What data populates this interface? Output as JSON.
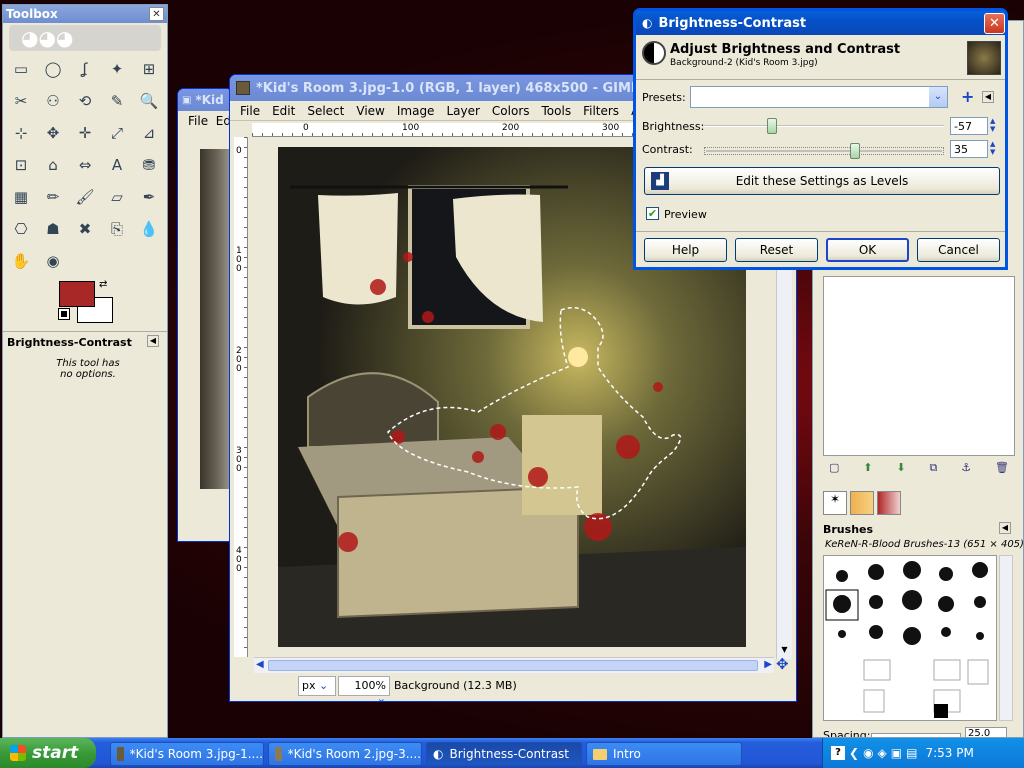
{
  "toolbox": {
    "title": "Toolbox",
    "tool_options_title": "Brightness-Contrast",
    "no_options": "This tool has no options."
  },
  "bg_window": {
    "title": "*Kid",
    "menu_file": "File",
    "menu_edit": "Ed"
  },
  "image_window": {
    "title": "*Kid's Room 3.jpg-1.0 (RGB, 1 layer) 468x500 - GIMP",
    "menu": [
      "File",
      "Edit",
      "Select",
      "View",
      "Image",
      "Layer",
      "Colors",
      "Tools",
      "Filters",
      "Animate"
    ],
    "ruler_h": [
      "0",
      "100",
      "200",
      "300"
    ],
    "ruler_v": [
      "0",
      "1\n0\n0",
      "2\n0\n0",
      "3\n0\n0",
      "4\n0\n0"
    ],
    "unit": "px",
    "zoom": "100%",
    "status": "Background (12.3 MB)"
  },
  "dialog": {
    "title": "Brightness-Contrast",
    "heading": "Adjust Brightness and Contrast",
    "subheading": "Background-2 (Kid's Room 3.jpg)",
    "presets_label": "Presets:",
    "presets_value": "",
    "brightness_label": "Brightness:",
    "brightness_value": "-57",
    "brightness_level": -57,
    "contrast_label": "Contrast:",
    "contrast_value": "35",
    "contrast_level": 35,
    "levels_button": "Edit these Settings as Levels",
    "preview_label": "Preview",
    "preview_checked": true,
    "help": "Help",
    "reset": "Reset",
    "ok": "OK",
    "cancel": "Cancel"
  },
  "right_dock": {
    "brushes_title": "Brushes",
    "brush_name": "KeReN-R-Blood Brushes-13 (651 × 405)",
    "spacing_label": "Spacing:",
    "spacing_value": "25.0"
  },
  "taskbar": {
    "start": "start",
    "items": [
      "*Kid's Room 3.jpg-1....",
      "*Kid's Room 2.jpg-3....",
      "Brightness-Contrast",
      "Intro"
    ],
    "clock": "7:53 PM"
  },
  "colors": {
    "fg": "#a82828",
    "bg": "#ffffff"
  }
}
